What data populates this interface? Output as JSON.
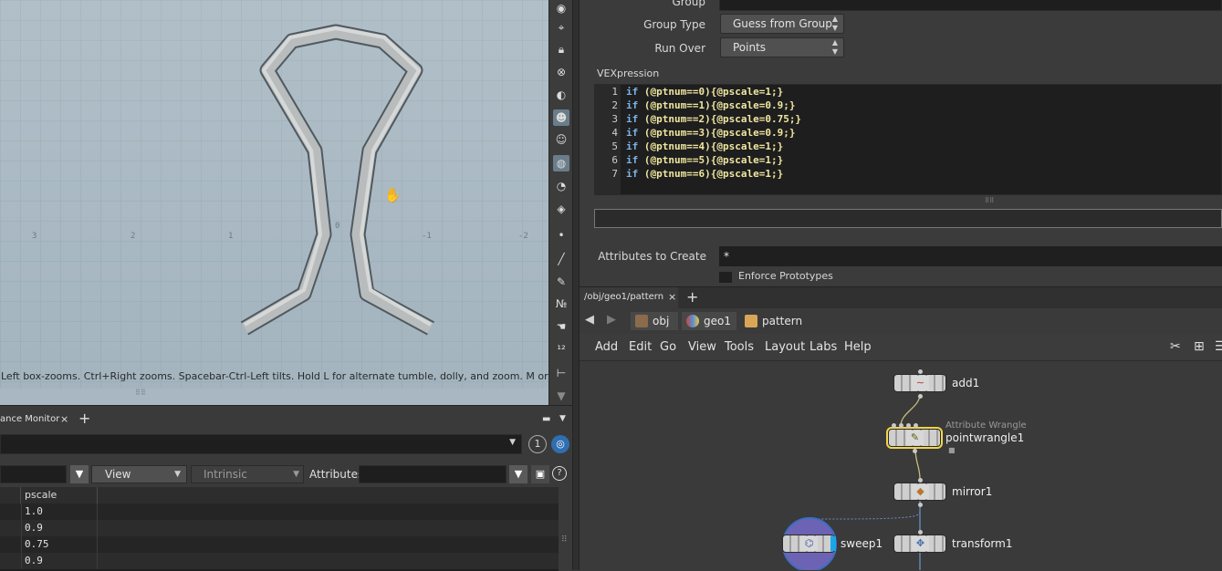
{
  "viewport": {
    "hint_text": "Left box-zooms. Ctrl+Right zooms. Spacebar-Ctrl-Left tilts. Hold L for alternate tumble, dolly, and zoom. M or Alt+M for",
    "axis_labels": [
      "3",
      "2",
      "1",
      "0",
      "-1",
      "-2"
    ]
  },
  "params": {
    "group_label": "Group",
    "group_type_label": "Group Type",
    "group_type_value": "Guess from Group",
    "run_over_label": "Run Over",
    "run_over_value": "Points",
    "vexpression_label": "VEXpression",
    "code_lines": [
      {
        "n": "1",
        "pre": "if",
        "body": " (@ptnum==0){@pscale=1;}"
      },
      {
        "n": "2",
        "pre": "if",
        "body": " (@ptnum==1){@pscale=0.9;}"
      },
      {
        "n": "3",
        "pre": "if",
        "body": " (@ptnum==2){@pscale=0.75;}"
      },
      {
        "n": "4",
        "pre": "if",
        "body": " (@ptnum==3){@pscale=0.9;}"
      },
      {
        "n": "5",
        "pre": "if",
        "body": " (@ptnum==4){@pscale=1;}"
      },
      {
        "n": "6",
        "pre": "if",
        "body": " (@ptnum==5){@pscale=1;}"
      },
      {
        "n": "7",
        "pre": "if",
        "body": " (@ptnum==6){@pscale=1;}"
      }
    ],
    "attributes_to_create_label": "Attributes to Create",
    "attributes_to_create_value": "*",
    "enforce_prototypes_label": "Enforce Prototypes"
  },
  "network": {
    "tab_label": "/obj/geo1/pattern",
    "tab_close": "×",
    "add_tab": "+",
    "breadcrumbs": [
      "obj",
      "geo1",
      "pattern"
    ],
    "menu": [
      "Add",
      "Edit",
      "Go",
      "View",
      "Tools",
      "Layout",
      "Labs",
      "Help"
    ],
    "nodes": {
      "add1": {
        "name": "add1"
      },
      "pointwrangle1": {
        "name": "pointwrangle1",
        "type": "Attribute Wrangle"
      },
      "mirror1": {
        "name": "mirror1"
      },
      "sweep1": {
        "name": "sweep1"
      },
      "transform1": {
        "name": "transform1"
      }
    }
  },
  "spreadsheet": {
    "tab_label": "ance Monitor",
    "tab_close": "×",
    "add_tab": "+",
    "view_label": "View",
    "intrinsics_label": "Intrinsic",
    "attributes_label": "Attributes:",
    "circle_number": "1",
    "column_header": "pscale",
    "rows": [
      "1.0",
      "0.9",
      "0.75",
      "0.9"
    ]
  },
  "colors": {
    "selection_outline": "#f1d54a",
    "code_keyword": "#7fb2e8",
    "code_attr": "#f0e7a0"
  }
}
